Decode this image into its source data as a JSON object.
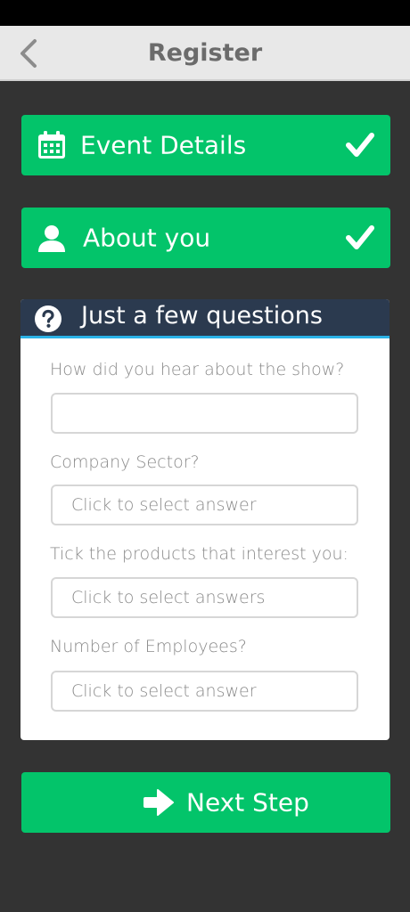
{
  "app_bar": {
    "title": "Register",
    "back_icon": "chevron-left-icon"
  },
  "steps": [
    {
      "label": "Event Details",
      "icon": "calendar-icon",
      "status": "complete"
    },
    {
      "label": "About you",
      "icon": "user-icon",
      "status": "complete"
    }
  ],
  "questions": {
    "title": "Just a few questions",
    "icon": "question-circle-icon",
    "items": [
      {
        "label": "How did you hear about the show?",
        "value": "",
        "placeholder": ""
      },
      {
        "label": "Company Sector?",
        "value": "",
        "placeholder": "Click to select answer"
      },
      {
        "label": "Tick the products that interest you:",
        "value": "",
        "placeholder": "Click to select answers"
      },
      {
        "label": "Number of Employees?",
        "value": "",
        "placeholder": "Click to select answer"
      }
    ]
  },
  "next_button": {
    "label": "Next Step",
    "icon": "arrow-right-icon"
  },
  "colors": {
    "background": "#333333",
    "accent_green": "#03c46a",
    "header_navy": "#2b3a4f",
    "header_underline": "#2bb3e8",
    "app_bar": "#e8e8e8"
  }
}
